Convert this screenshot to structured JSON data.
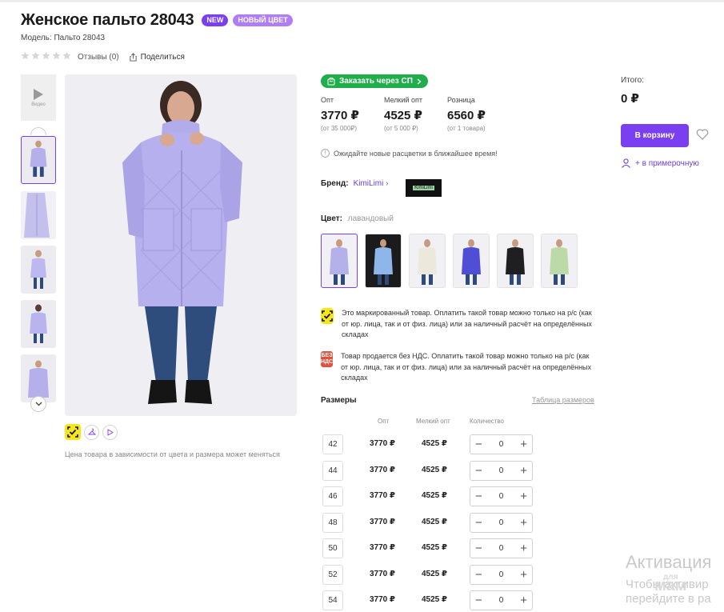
{
  "product": {
    "title": "Женское пальто 28043",
    "badge_new": "NEW",
    "badge_color": "НОВЫЙ ЦВЕТ",
    "model": "Модель: Пальто 28043",
    "rating_stars": 0,
    "reviews": "Отзывы (0)",
    "share": "Поделиться"
  },
  "gallery": {
    "video_label": "Видео",
    "thumb_count": 5,
    "price_note": "Цена товара в зависимости от цвета и размера может меняться"
  },
  "order_sp": "Заказать через СП",
  "prices": [
    {
      "label": "Опт",
      "value": "3770 ₽",
      "note": "(от 35 000₽)"
    },
    {
      "label": "Мелкий опт",
      "value": "4525 ₽",
      "note": "(от 5 000 ₽)"
    },
    {
      "label": "Розница",
      "value": "6560 ₽",
      "note": "(от 1 товара)"
    }
  ],
  "wait_note": "Ожидайте новые расцветки в ближайшее время!",
  "brand": {
    "label": "Бренд:",
    "name": "KimiLimi",
    "logo_text": "KimiLimi"
  },
  "color": {
    "label": "Цвет:",
    "value": "лавандовый",
    "swatches": [
      {
        "name": "лавандовый",
        "hex": "#b4b0ea",
        "active": true
      },
      {
        "name": "голубой",
        "hex": "#8fb6e8",
        "active": false
      },
      {
        "name": "молочный",
        "hex": "#ece8dc",
        "active": false
      },
      {
        "name": "синий",
        "hex": "#4f4fd6",
        "active": false
      },
      {
        "name": "черный",
        "hex": "#1f1f22",
        "active": false
      },
      {
        "name": "фисташковый",
        "hex": "#bcd9a8",
        "active": false
      }
    ]
  },
  "notices": {
    "marked": "Это маркированный товар. Оплатить такой товар можно только на р/с (как от юр. лица, так и от физ. лица) или за наличный расчёт на определённых складах",
    "nds_icon": "БЕЗ НДС",
    "nds": "Товар продается без НДС. Оплатить такой товар можно только на р/с (как от юр. лица, так и от физ. лица) или за наличный расчёт на определённых складах"
  },
  "sizes": {
    "title": "Размеры",
    "table_link": "Таблица размеров",
    "headers": {
      "opt": "Опт",
      "small": "Мелкий опт",
      "qty": "Количество"
    },
    "rows": [
      {
        "size": "42",
        "opt": "3770 ₽",
        "small": "4525 ₽",
        "qty": "0"
      },
      {
        "size": "44",
        "opt": "3770 ₽",
        "small": "4525 ₽",
        "qty": "0"
      },
      {
        "size": "46",
        "opt": "3770 ₽",
        "small": "4525 ₽",
        "qty": "0"
      },
      {
        "size": "48",
        "opt": "3770 ₽",
        "small": "4525 ₽",
        "qty": "0"
      },
      {
        "size": "50",
        "opt": "3770 ₽",
        "small": "4525 ₽",
        "qty": "0"
      },
      {
        "size": "52",
        "opt": "3770 ₽",
        "small": "4525 ₽",
        "qty": "0"
      },
      {
        "size": "54",
        "opt": "3770 ₽",
        "small": "4525 ₽",
        "qty": "0"
      }
    ]
  },
  "summary": {
    "total_label": "Итого:",
    "total_value": "0 ₽",
    "cart_button": "В корзину",
    "fitting": "+ в примерочную"
  },
  "os_overlay": {
    "activation": "Активация",
    "line1": "Чтобы активир",
    "line2": "перейдите в ра",
    "watermark_top": "для",
    "watermark_bottom": "мам"
  },
  "colors": {
    "accent": "#7b3ff2",
    "green": "#1fae4a",
    "link": "#6c3ce0",
    "mark_yellow": "#f5e51c",
    "nds_red": "#e2513a"
  }
}
